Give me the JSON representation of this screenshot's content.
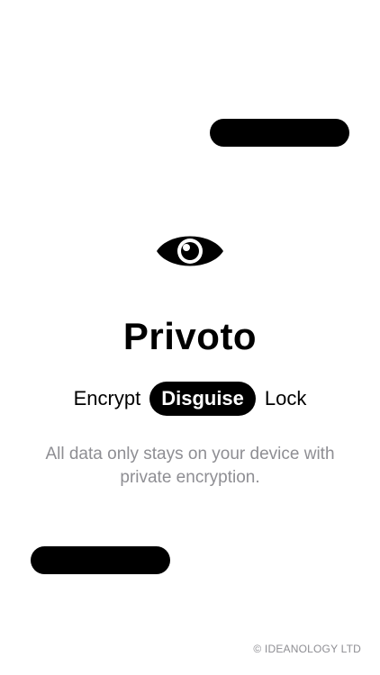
{
  "app": {
    "title": "Privoto",
    "logo_icon": "eye-icon"
  },
  "features": [
    {
      "label": "Encrypt",
      "active": false
    },
    {
      "label": "Disguise",
      "active": true
    },
    {
      "label": "Lock",
      "active": false
    }
  ],
  "tagline": "All data only stays on your device with private encryption.",
  "footer": {
    "copyright": "© IDEANOLOGY LTD"
  },
  "colors": {
    "primary": "#000000",
    "background": "#ffffff",
    "muted_text": "#8e8e93"
  }
}
